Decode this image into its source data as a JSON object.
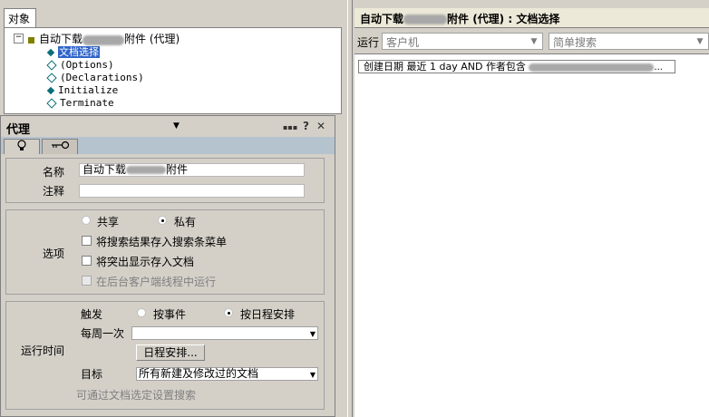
{
  "left_pane": {
    "tab_label": "对象",
    "tree": {
      "root_label_prefix": "自动下载",
      "root_label_suffix": "附件 (代理)",
      "children": [
        {
          "label": "文档选择",
          "selected": true
        },
        {
          "label": "(Options)"
        },
        {
          "label": "(Declarations)"
        },
        {
          "label": "Initialize"
        },
        {
          "label": "Terminate"
        }
      ]
    }
  },
  "right_pane": {
    "title_prefix": "自动下载",
    "title_suffix": "附件 (代理) : 文档选择",
    "run_label": "运行",
    "run_target": "客户机",
    "search_mode": "简单搜索",
    "query_text": "创建日期 最近 1 day AND 作者包含"
  },
  "properties": {
    "title": "代理",
    "close_glyph": "✕",
    "help_glyph": "?",
    "menu_glyph": "▪▪▪",
    "name_label": "名称",
    "name_prefix": "自动下载",
    "name_suffix": "附件",
    "comment_label": "注释",
    "comment_value": "",
    "share_label": "共享",
    "private_label": "私有",
    "visibility": "private",
    "options_label": "选项",
    "opt_store_results": "将搜索结果存入搜索条菜单",
    "opt_store_highlights": "将突出显示存入文档",
    "opt_background": "在后台客户端线程中运行",
    "runtime_label": "运行时间",
    "trigger_label": "触发",
    "on_event_label": "按事件",
    "on_schedule_label": "按日程安排",
    "trigger": "schedule",
    "schedule_value": "每周一次",
    "schedule_button": "日程安排...",
    "target_label": "目标",
    "target_value": "所有新建及修改过的文档",
    "target_hint": "可通过文档选定设置搜索"
  }
}
